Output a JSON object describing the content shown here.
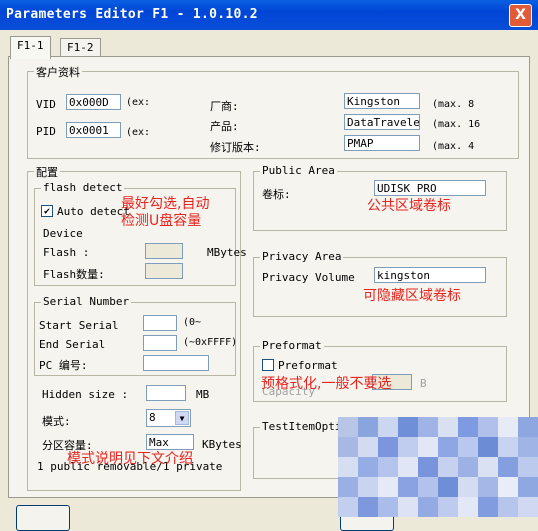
{
  "window": {
    "title": "Parameters Editor F1 - 1.0.10.2",
    "close_label": "X"
  },
  "tabs": [
    {
      "label": "F1-1"
    },
    {
      "label": "F1-2"
    }
  ],
  "customer": {
    "legend": "客户资料",
    "vid_label": "VID",
    "vid_value": "0x000D",
    "vid_hint": "(ex:",
    "pid_label": "PID",
    "pid_value": "0x0001",
    "pid_hint": "(ex:",
    "vendor_label": "厂商:",
    "vendor_value": "Kingston",
    "vendor_hint": "(max. 8",
    "product_label": "产品:",
    "product_value": "DataTraveler",
    "product_hint": "(max. 16",
    "rev_label": "修订版本:",
    "rev_value": "PMAP",
    "rev_hint": "(max. 4"
  },
  "config": {
    "legend": "配置",
    "flash": {
      "legend": "flash detect",
      "auto_label": "Auto detect",
      "auto_checked": "✔",
      "device_label": "Device",
      "flash_label": "Flash :",
      "flash_unit": "MBytes",
      "count_label": "Flash数量:"
    },
    "serial": {
      "legend": "Serial Number",
      "start_label": "Start Serial",
      "start_hint": "(0~",
      "end_label": "End Serial",
      "end_hint": "(~0xFFFF)",
      "pc_label": "PC 编号:"
    },
    "hidden_label": "Hidden size :",
    "hidden_unit": "MB",
    "mode_label": "模式:",
    "mode_value": "8",
    "partition_label": "分区容量:",
    "partition_value": "Max",
    "partition_unit": "KBytes",
    "footer": "1 public removable/1 private"
  },
  "public_area": {
    "legend": "Public Area",
    "label": "卷标:",
    "value": "UDISK PRO"
  },
  "privacy_area": {
    "legend": "Privacy Area",
    "label": "Privacy Volume",
    "value": "kingston"
  },
  "preformat": {
    "legend": "Preformat",
    "checkbox_label": "Preformat",
    "capacity_label": "Capacity",
    "unit": "B"
  },
  "test": {
    "legend": "TestItemOption"
  },
  "annotations": {
    "a1": "最好勾选,自动",
    "a2": "检测U盘容量",
    "a3": "公共区域卷标",
    "a4": "可隐藏区域卷标",
    "a5": "预格式化,一般不要选",
    "a6": "模式说明见下文介绍"
  },
  "colors": {
    "title_bar": "#0a4fd8",
    "annotation": "#e8231e",
    "dialog_bg": "#ece9d8"
  }
}
